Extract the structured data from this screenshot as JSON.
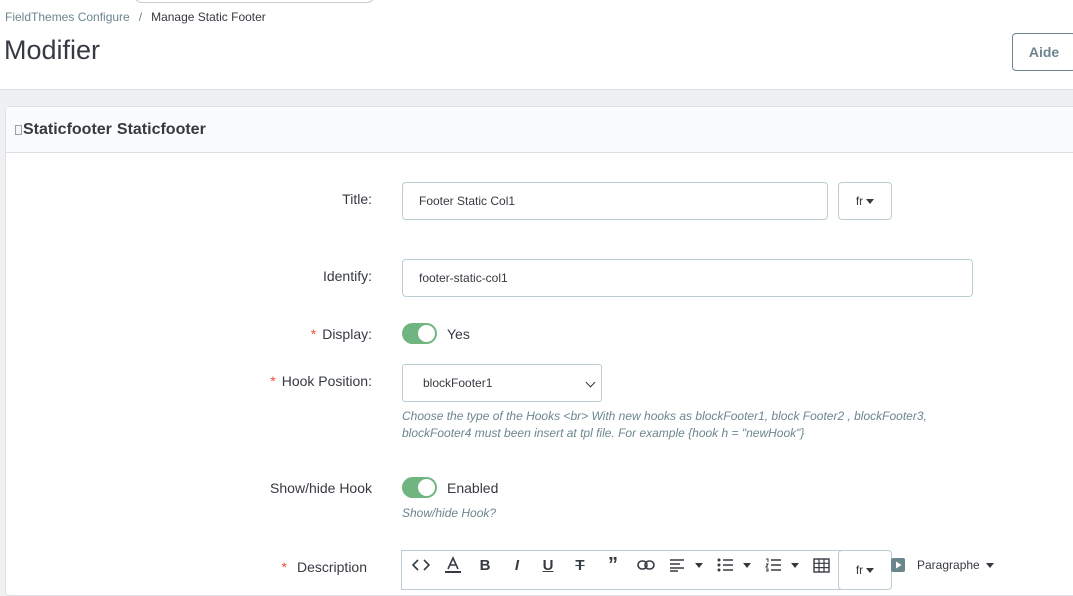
{
  "breadcrumb": {
    "parent": "FieldThemes Configure",
    "separator": "/",
    "current": "Manage Static Footer"
  },
  "page": {
    "title": "Modifier",
    "help_label": "Aide"
  },
  "panel": {
    "image_alt": "Staticfooter",
    "heading": "Staticfooter"
  },
  "form": {
    "title": {
      "label": "Title:",
      "value": "Footer Static Col1",
      "lang": "fr"
    },
    "identify": {
      "label": "Identify:",
      "value": "footer-static-col1"
    },
    "display": {
      "required": "*",
      "label": "Display:",
      "state": "Yes",
      "on": true
    },
    "hook_position": {
      "required": "*",
      "label": "Hook Position:",
      "selected": "blockFooter1",
      "help": "Choose the type of the Hooks <br> With new hooks as blockFooter1, block Footer2 , blockFooter3, blockFooter4 must been insert at tpl file. For example {hook h = \"newHook\"}"
    },
    "show_hide_hook": {
      "label": "Show/hide Hook",
      "state": "Enabled",
      "on": true,
      "help": "Show/hide Hook?"
    },
    "description": {
      "required": "*",
      "label": "Description",
      "lang": "fr",
      "block_format": "Paragraphe",
      "toolbar_icons": [
        "source-code-icon",
        "text-color-icon",
        "bold-icon",
        "italic-icon",
        "underline-icon",
        "strikethrough-icon",
        "blockquote-icon",
        "link-icon",
        "align-icon",
        "bullet-list-icon",
        "numbered-list-icon",
        "table-icon",
        "media-icon"
      ]
    }
  },
  "colors": {
    "toggle_on": "#70b580",
    "required": "#f54c3e",
    "help_text": "#6c868e"
  }
}
